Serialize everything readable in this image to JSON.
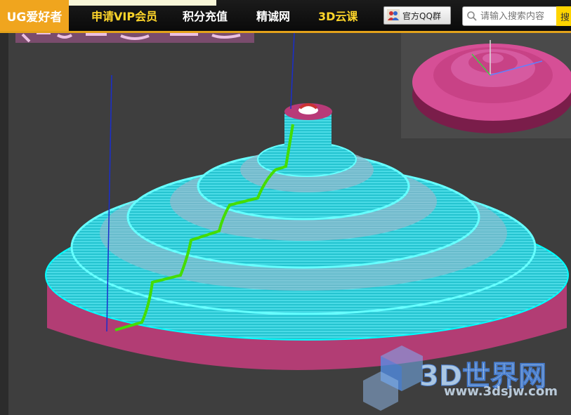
{
  "brand": {
    "logo": "UG爱好者"
  },
  "nav": {
    "items": [
      {
        "label": "申请VIP会员",
        "color": "#ffd62a"
      },
      {
        "label": "积分充值",
        "color": "#ffffff"
      },
      {
        "label": "精诚网",
        "color": "#ffffff"
      },
      {
        "label": "3D云课",
        "color": "#ffd62a"
      }
    ]
  },
  "qq_group": {
    "label": "官方QQ群",
    "icon": "people-icon"
  },
  "search": {
    "placeholder": "请输入搜索内容",
    "icon": "search-icon",
    "button_label": "搜"
  },
  "watermark": {
    "brand": "3D世界网",
    "url": "www.3dsjw.com"
  },
  "colors": {
    "accent": "#f0a51e",
    "toolpath": "#00f0f0",
    "part": "#c0407e",
    "highlight": "#44dd00"
  }
}
